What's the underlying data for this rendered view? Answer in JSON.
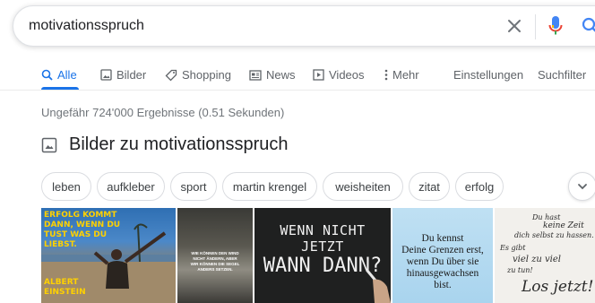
{
  "search": {
    "query": "motivationsspruch"
  },
  "icons": {
    "clear": "close-icon",
    "mic": "microphone-icon",
    "search": "search-icon"
  },
  "colors": {
    "accent": "#1a73e8",
    "mic_red": "#ea4335",
    "mic_yellow": "#fbbc04",
    "mic_green": "#34a853"
  },
  "tabs": [
    {
      "label": "Alle",
      "icon": "search-icon",
      "active": true
    },
    {
      "label": "Bilder",
      "icon": "image-icon"
    },
    {
      "label": "Shopping",
      "icon": "tag-icon"
    },
    {
      "label": "News",
      "icon": "news-icon"
    },
    {
      "label": "Videos",
      "icon": "play-icon"
    },
    {
      "label": "Mehr",
      "icon": "more-vert-icon"
    },
    {
      "label": "Einstellungen"
    },
    {
      "label": "Suchfilter"
    }
  ],
  "result_stats": "Ungefähr 724'000 Ergebnisse (0.51 Sekunden)",
  "images_section": {
    "title": "Bilder zu motivationsspruch",
    "chips": [
      "leben",
      "aufkleber",
      "sport",
      "martin krengel",
      "weisheiten",
      "zitat",
      "erfolg"
    ],
    "thumbs": {
      "t1": [
        "ERFOLG KOMMT",
        "DANN, WENN DU",
        "TUST WAS DU",
        "LIEBST.",
        "ALBERT",
        "EINSTEIN"
      ],
      "t2": [
        "WIE KÖNNEN DEN WIND",
        "NICHT ÄNDERN, ABER",
        "WIR KÖNNEN DIE SEGEL",
        "ANDERS SETZEN."
      ],
      "t3": [
        "WENN NICHT JETZT",
        "WANN DANN?"
      ],
      "t4": [
        "Du kennst",
        "Deine Grenzen erst,",
        "wenn Du über sie",
        "hinausgewachsen",
        "bist."
      ],
      "t5": [
        "Du hast",
        "keine Zeit",
        "dich selbst zu hassen.",
        "Es gibt",
        "viel zu viel",
        "zu tun!",
        "Los jetzt!"
      ]
    }
  }
}
